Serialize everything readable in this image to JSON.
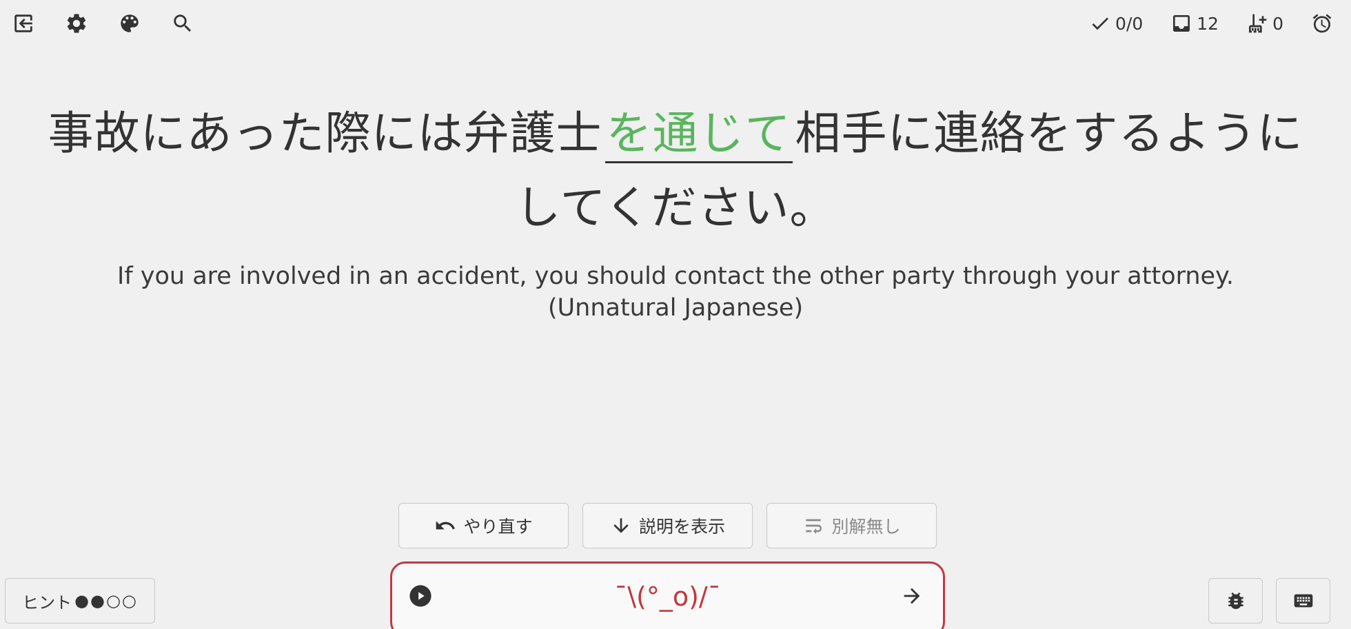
{
  "toolbar": {
    "icons": [
      "exit-icon",
      "gear-icon",
      "palette-icon",
      "search-icon"
    ]
  },
  "stats": {
    "reviewed": "0/0",
    "inbox": "12",
    "cleanup": "0",
    "timer_icon": "alarm-clock-icon"
  },
  "sentence": {
    "before": "事故にあった際には弁護士",
    "target": "を通じて",
    "after": "相手に連絡をするようにしてください。"
  },
  "translation": "If you are involved in an accident, you should contact the other party through your attorney. (Unnatural Japanese)",
  "actions": {
    "undo_label": "やり直す",
    "explain_label": "説明を表示",
    "alt_label": "別解無し"
  },
  "answer": {
    "value": "¯\\(°_o)/¯"
  },
  "hint": {
    "label": "ヒント",
    "dots": "●●○○"
  },
  "colors": {
    "accent_green": "#5ab55e",
    "error_red": "#c0393f",
    "background": "#f0f0f0",
    "text": "#333333"
  }
}
